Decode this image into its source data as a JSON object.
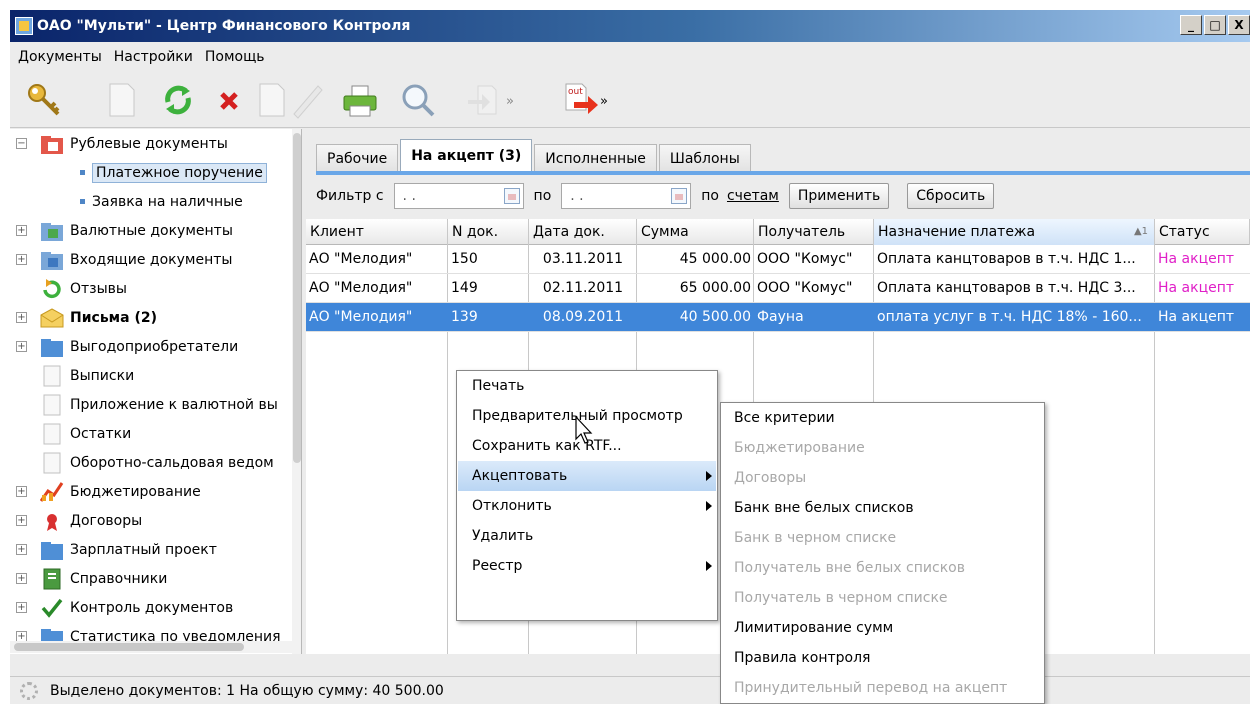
{
  "window": {
    "title": "ОАО \"Мульти\" - Центр Финансового Контроля",
    "btn_min": "_",
    "btn_max": "□",
    "btn_close": "X"
  },
  "menu": [
    "Документы",
    "Настройки",
    "Помощь"
  ],
  "toolbar": {
    "out_label": "out"
  },
  "tree": [
    {
      "label": "Рублевые документы",
      "icon": "ruble-folder-icon",
      "expander": "−"
    },
    {
      "label": "Платежное поручение",
      "icon": "bullet",
      "selected": true
    },
    {
      "label": "Заявка на наличные",
      "icon": "bullet"
    },
    {
      "label": "Валютные документы",
      "icon": "currency-folder-icon",
      "expander": "+"
    },
    {
      "label": "Входящие документы",
      "icon": "incoming-folder-icon",
      "expander": "+"
    },
    {
      "label": "Отзывы",
      "icon": "refresh-green-icon"
    },
    {
      "label": "Письма (2)",
      "icon": "envelope-icon",
      "expander": "+",
      "bold": true
    },
    {
      "label": "Выгодоприобретатели",
      "icon": "folder-blue-icon",
      "expander": "+"
    },
    {
      "label": "Выписки",
      "icon": "document-icon"
    },
    {
      "label": "Приложение к валютной вы",
      "icon": "document-icon"
    },
    {
      "label": "Остатки",
      "icon": "document-icon"
    },
    {
      "label": "Оборотно-сальдовая ведом",
      "icon": "document-icon"
    },
    {
      "label": "Бюджетирование",
      "icon": "chart-icon",
      "expander": "+"
    },
    {
      "label": "Договоры",
      "icon": "seal-icon",
      "expander": "+"
    },
    {
      "label": "Зарплатный проект",
      "icon": "folder-blue-icon",
      "expander": "+"
    },
    {
      "label": "Справочники",
      "icon": "book-icon",
      "expander": "+"
    },
    {
      "label": "Контроль документов",
      "icon": "checkmark-icon",
      "expander": "+"
    },
    {
      "label": "Статистика по уведомления",
      "icon": "folder-blue-icon",
      "expander": "+"
    }
  ],
  "tabs": [
    {
      "label": "Рабочие",
      "active": false
    },
    {
      "label": "На акцепт (3)",
      "active": true
    },
    {
      "label": "Исполненные",
      "active": false
    },
    {
      "label": "Шаблоны",
      "active": false
    }
  ],
  "filter": {
    "label_from": "Фильтр  с",
    "date_from": ". .",
    "label_to": "по",
    "date_to": ". .",
    "label_by": "по",
    "link_accounts": "счетам",
    "apply": "Применить",
    "reset": "Сбросить"
  },
  "grid": {
    "columns": [
      "Клиент",
      "N док.",
      "Дата док.",
      "Сумма",
      "Получатель",
      "Назначение платежа",
      "Статус"
    ],
    "sort_mark": "▲1",
    "rows": [
      [
        "АО \"Мелодия\"",
        "150",
        "03.11.2011",
        "45 000.00",
        "ООО \"Комус\"",
        "Оплата канцтоваров в т.ч. НДС 1...",
        "На акцепт"
      ],
      [
        "АО \"Мелодия\"",
        "149",
        "02.11.2011",
        "65 000.00",
        "ООО \"Комус\"",
        "Оплата канцтоваров в т.ч. НДС 3...",
        "На акцепт"
      ],
      [
        "АО \"Мелодия\"",
        "139",
        "08.09.2011",
        "40 500.00",
        "Фауна",
        "оплата услуг в т.ч. НДС 18% - 160...",
        "На акцепт"
      ]
    ]
  },
  "context_menu": [
    {
      "label": "Печать"
    },
    {
      "label": "Предварительный просмотр"
    },
    {
      "label": "Сохранить как RTF..."
    },
    {
      "label": "Акцептовать",
      "submenu": true,
      "hover": true
    },
    {
      "label": "Отклонить",
      "submenu": true
    },
    {
      "label": "Удалить"
    },
    {
      "label": "Реестр",
      "submenu": true
    }
  ],
  "submenu": [
    {
      "label": "Все критерии",
      "enabled": true
    },
    {
      "label": "Бюджетирование",
      "enabled": false
    },
    {
      "label": "Договоры",
      "enabled": false
    },
    {
      "label": "Банк вне белых списков",
      "enabled": true
    },
    {
      "label": "Банк в черном списке",
      "enabled": false
    },
    {
      "label": "Получатель вне белых списков",
      "enabled": false
    },
    {
      "label": "Получатель в черном списке",
      "enabled": false
    },
    {
      "label": "Лимитирование сумм",
      "enabled": true
    },
    {
      "label": "Правила контроля",
      "enabled": true
    },
    {
      "label": "Принудительный перевод на акцепт",
      "enabled": false
    }
  ],
  "status": {
    "text": "Выделено документов: 1 На общую сумму: 40 500.00"
  },
  "colors": {
    "title_start": "#0a246a",
    "title_end": "#a6caf0",
    "selection": "#3f86d9",
    "status_pink": "#e020c8",
    "tab_line": "#6aa7e8"
  }
}
